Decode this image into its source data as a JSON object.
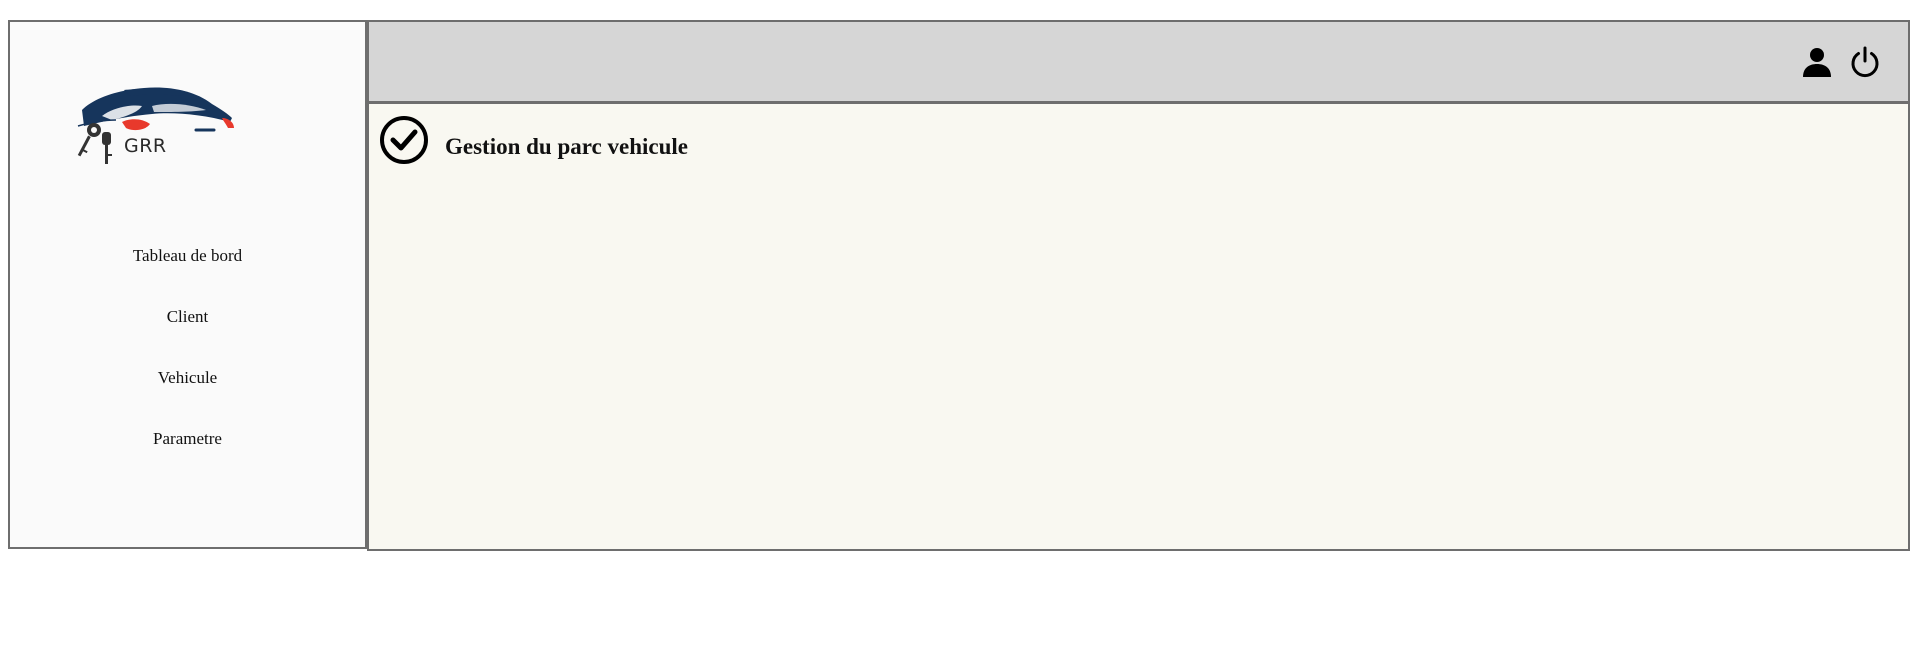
{
  "brand": {
    "name": "GRR",
    "logo_colors": {
      "body": "#16355c",
      "accent": "#e8392c"
    }
  },
  "sidebar": {
    "items": [
      {
        "label": "Tableau de bord"
      },
      {
        "label": "Client"
      },
      {
        "label": "Vehicule"
      },
      {
        "label": "Parametre"
      }
    ]
  },
  "header": {
    "icons": [
      "user-icon",
      "power-icon"
    ]
  },
  "main": {
    "title": "Gestion du parc vehicule",
    "title_icon": "check-circle-icon"
  }
}
